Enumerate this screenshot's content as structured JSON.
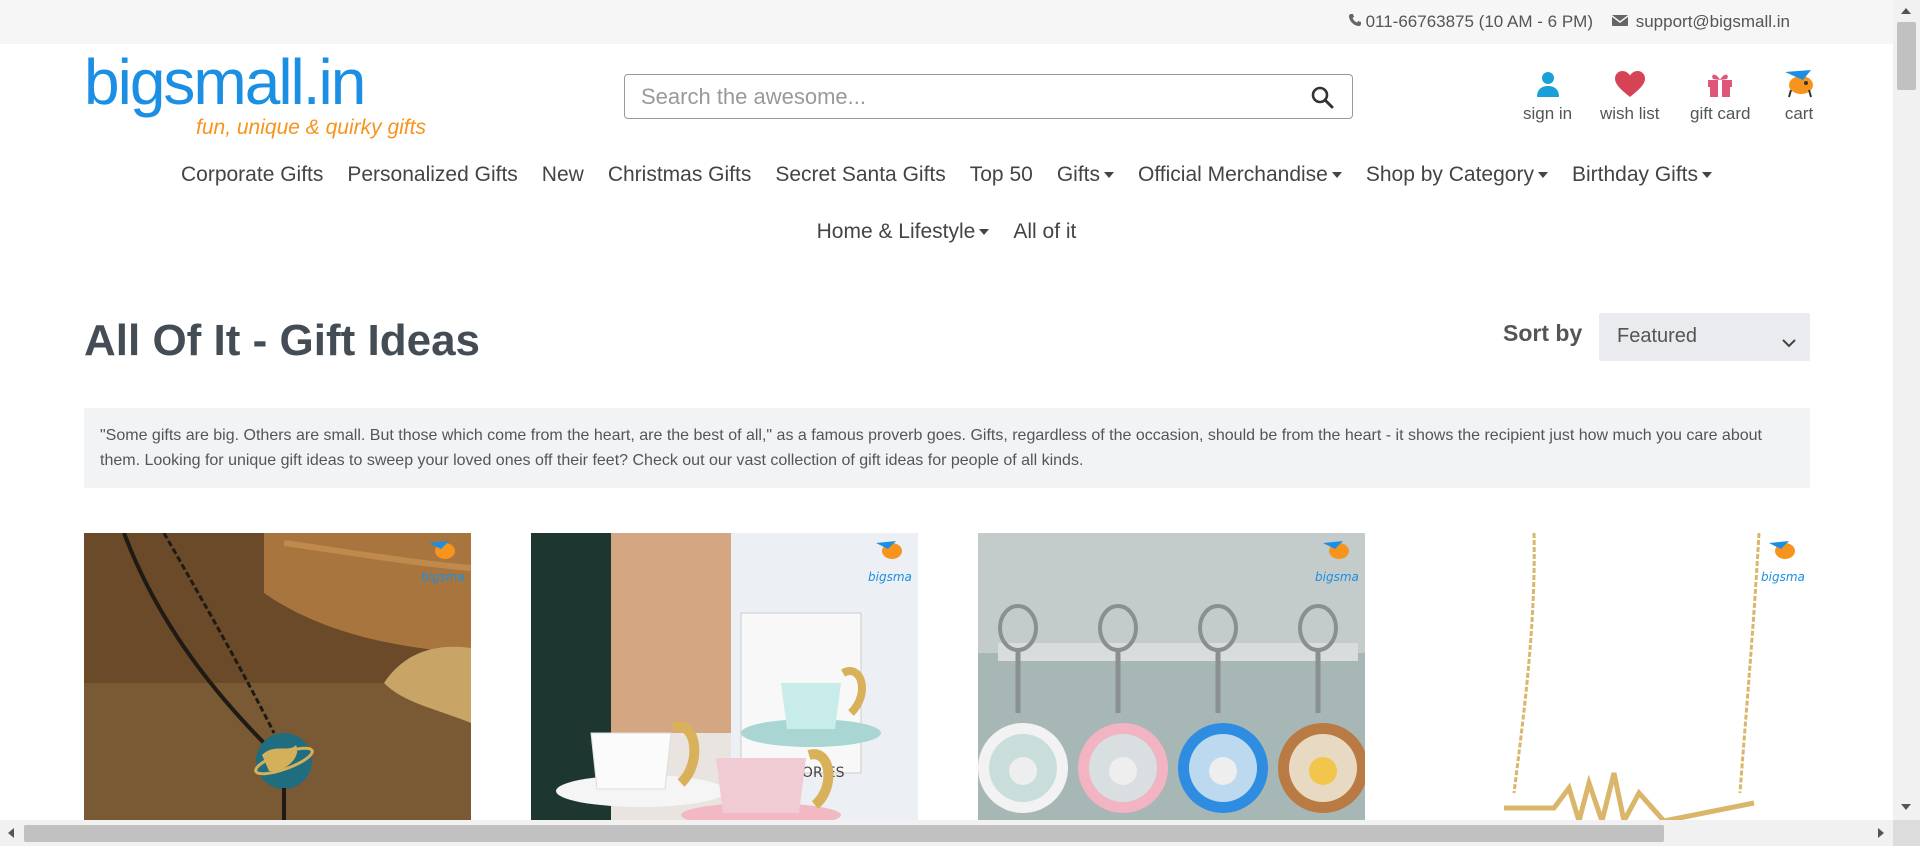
{
  "topbar": {
    "phone": "011-66763875 (10 AM - 6 PM)",
    "email": "support@bigsmall.in",
    "phone_icon": "phone-icon",
    "email_icon": "envelope-icon"
  },
  "logo": {
    "word": "bigsmall.in",
    "tagline": "fun, unique & quirky gifts"
  },
  "search": {
    "placeholder": "Search the awesome...",
    "icon": "search-icon"
  },
  "header_actions": [
    {
      "label": "sign in",
      "icon": "user-icon"
    },
    {
      "label": "wish list",
      "icon": "heart-icon"
    },
    {
      "label": "gift card",
      "icon": "gift-icon"
    },
    {
      "label": "cart",
      "icon": "cart-icon"
    }
  ],
  "nav_row1": [
    "Corporate Gifts",
    "Personalized Gifts",
    "New",
    "Christmas Gifts",
    "Secret Santa Gifts",
    "Top 50",
    "Gifts",
    "Official Merchandise",
    "Shop by Category",
    "Birthday Gifts"
  ],
  "nav_row2": [
    "Home & Lifestyle",
    "All of it"
  ],
  "page": {
    "title": "All Of It - Gift Ideas"
  },
  "sort": {
    "label": "Sort by",
    "selected": "Featured"
  },
  "description": "\"Some gifts are big. Others are small. But those which come from the heart, are the best of all,\" as a famous proverb goes. Gifts, regardless of the occasion, should be from the heart - it shows the recipient just how much you care about them. Looking for unique gift ideas to sweep your loved ones off their feet? Check out our vast collection of gift ideas for people of all kinds.",
  "products": [
    {
      "image": "globe pendant necklace",
      "watermark": "bigsmall.in"
    },
    {
      "image": "winged cups and saucers",
      "watermark": "bigsmall.in"
    },
    {
      "image": "bear keychains",
      "watermark": "bigsmall.in"
    },
    {
      "image": "heartbeat necklace",
      "watermark": "bigsmall.in"
    }
  ],
  "colors": {
    "brand_blue": "#1a8fe3",
    "brand_orange": "#f7941d",
    "text_dark": "#444d55"
  }
}
